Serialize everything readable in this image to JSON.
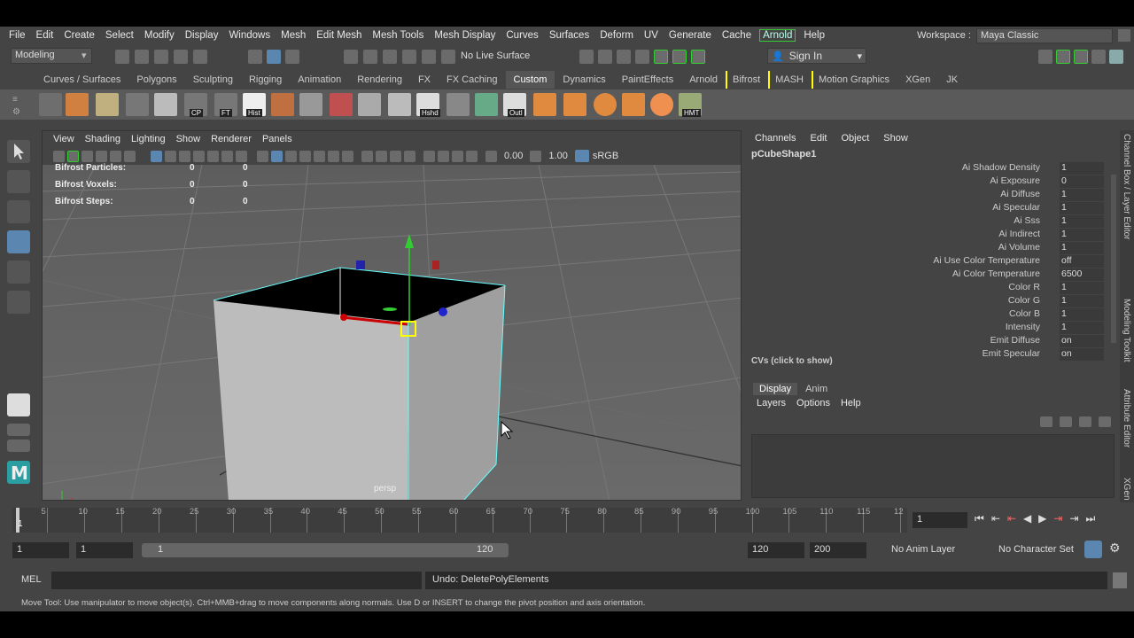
{
  "menubar": {
    "items": [
      "File",
      "Edit",
      "Create",
      "Select",
      "Modify",
      "Display",
      "Windows",
      "Mesh",
      "Edit Mesh",
      "Mesh Tools",
      "Mesh Display",
      "Curves",
      "Surfaces",
      "Deform",
      "UV",
      "Generate",
      "Cache",
      "Arnold",
      "Help"
    ],
    "workspace_label": "Workspace :",
    "workspace_value": "Maya Classic"
  },
  "statusline": {
    "mode": "Modeling",
    "live_surface": "No Live Surface",
    "sign_in": "Sign In"
  },
  "shelf": {
    "tabs": [
      "Curves / Surfaces",
      "Polygons",
      "Sculpting",
      "Rigging",
      "Animation",
      "Rendering",
      "FX",
      "FX Caching",
      "Custom",
      "Dynamics",
      "PaintEffects",
      "Arnold",
      "Bifrost",
      "MASH",
      "Motion Graphics",
      "XGen",
      "JK"
    ],
    "active_tab": "Custom",
    "icon_labels": [
      "CP",
      "FT",
      "Hist",
      "Hshd",
      "Outl",
      "HMT"
    ]
  },
  "viewport": {
    "menu": [
      "View",
      "Shading",
      "Lighting",
      "Show",
      "Renderer",
      "Panels"
    ],
    "near_clip": "0.00",
    "gamma": "1.00",
    "color_space": "sRGB",
    "hud": [
      {
        "label": "Bifrost Particles:",
        "a": "0",
        "b": "0"
      },
      {
        "label": "Bifrost Voxels:",
        "a": "0",
        "b": "0"
      },
      {
        "label": "Bifrost Steps:",
        "a": "0",
        "b": "0"
      }
    ],
    "camera": "persp"
  },
  "channelbox": {
    "menu": [
      "Channels",
      "Edit",
      "Object",
      "Show"
    ],
    "object": "pCubeShape1",
    "attrs": [
      {
        "name": "Ai Shadow Density",
        "value": "1"
      },
      {
        "name": "Ai Exposure",
        "value": "0"
      },
      {
        "name": "Ai Diffuse",
        "value": "1"
      },
      {
        "name": "Ai Specular",
        "value": "1"
      },
      {
        "name": "Ai Sss",
        "value": "1"
      },
      {
        "name": "Ai Indirect",
        "value": "1"
      },
      {
        "name": "Ai Volume",
        "value": "1"
      },
      {
        "name": "Ai Use Color Temperature",
        "value": "off"
      },
      {
        "name": "Ai Color Temperature",
        "value": "6500"
      },
      {
        "name": "Color R",
        "value": "1"
      },
      {
        "name": "Color G",
        "value": "1"
      },
      {
        "name": "Color B",
        "value": "1"
      },
      {
        "name": "Intensity",
        "value": "1"
      },
      {
        "name": "Emit Diffuse",
        "value": "on"
      },
      {
        "name": "Emit Specular",
        "value": "on"
      }
    ],
    "cvs": "CVs (click to show)"
  },
  "layers": {
    "tabs": [
      "Display",
      "Anim"
    ],
    "menu": [
      "Layers",
      "Options",
      "Help"
    ]
  },
  "rightstrip": [
    "Channel Box / Layer Editor",
    "Modeling Toolkit",
    "Attribute Editor",
    "XGen"
  ],
  "timeline": {
    "ticks": [
      "5",
      "10",
      "15",
      "20",
      "25",
      "30",
      "35",
      "40",
      "45",
      "50",
      "55",
      "60",
      "65",
      "70",
      "75",
      "80",
      "85",
      "90",
      "95",
      "100",
      "105",
      "110",
      "115",
      "12"
    ],
    "current_frame": "1",
    "start_tick": "1"
  },
  "range": {
    "start": "1",
    "anim_start": "1",
    "slider_start": "1",
    "slider_end": "120",
    "end": "120",
    "anim_end": "200",
    "anim_layer": "No Anim Layer",
    "char_set": "No Character Set"
  },
  "cmdline": {
    "lang": "MEL",
    "result": "Undo: DeletePolyElements"
  },
  "helpline": "Move Tool: Use manipulator to move object(s). Ctrl+MMB+drag to move components along normals. Use D or INSERT to change the pivot position and axis orientation.",
  "colors": {
    "accent": "#5aa0d8",
    "active_green": "#33cc33",
    "bg": "#444444"
  }
}
